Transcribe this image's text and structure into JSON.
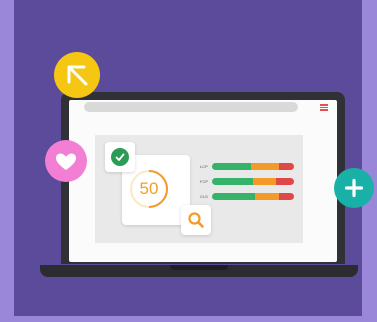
{
  "gauge": {
    "score": "50"
  },
  "metrics": [
    {
      "label": "LCP"
    },
    {
      "label": "FCP"
    },
    {
      "label": "CLS"
    }
  ],
  "icons": {
    "arrow": "arrow-up-left-icon",
    "heart": "heart-icon",
    "plus": "plus-icon",
    "check": "check-icon",
    "search": "search-icon",
    "menu": "hamburger-menu-icon"
  },
  "colors": {
    "background": "#9b87d9",
    "panel": "#5b4b9a",
    "good": "#35b36a",
    "needs_improvement": "#f39a29",
    "poor": "#e04848",
    "arrow_circle": "#f5c612",
    "heart_circle": "#f27fd4",
    "plus_circle": "#19b0a7"
  }
}
